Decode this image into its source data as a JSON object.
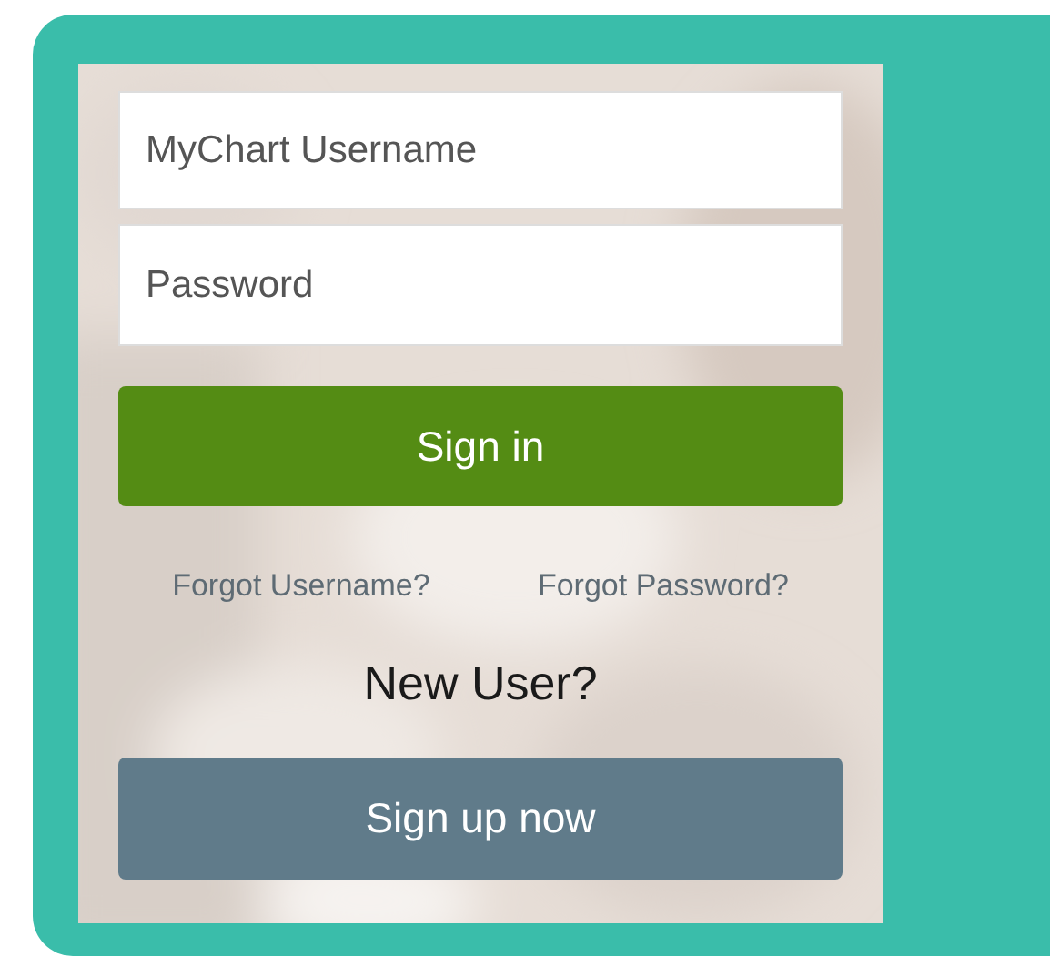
{
  "login": {
    "username": {
      "placeholder": "MyChart Username"
    },
    "password": {
      "placeholder": "Password"
    },
    "sign_in": "Sign in",
    "links": [
      "Forgot Username?",
      "Forgot Password?"
    ],
    "new_user": "New User?",
    "sign_up": "Sign up now"
  }
}
